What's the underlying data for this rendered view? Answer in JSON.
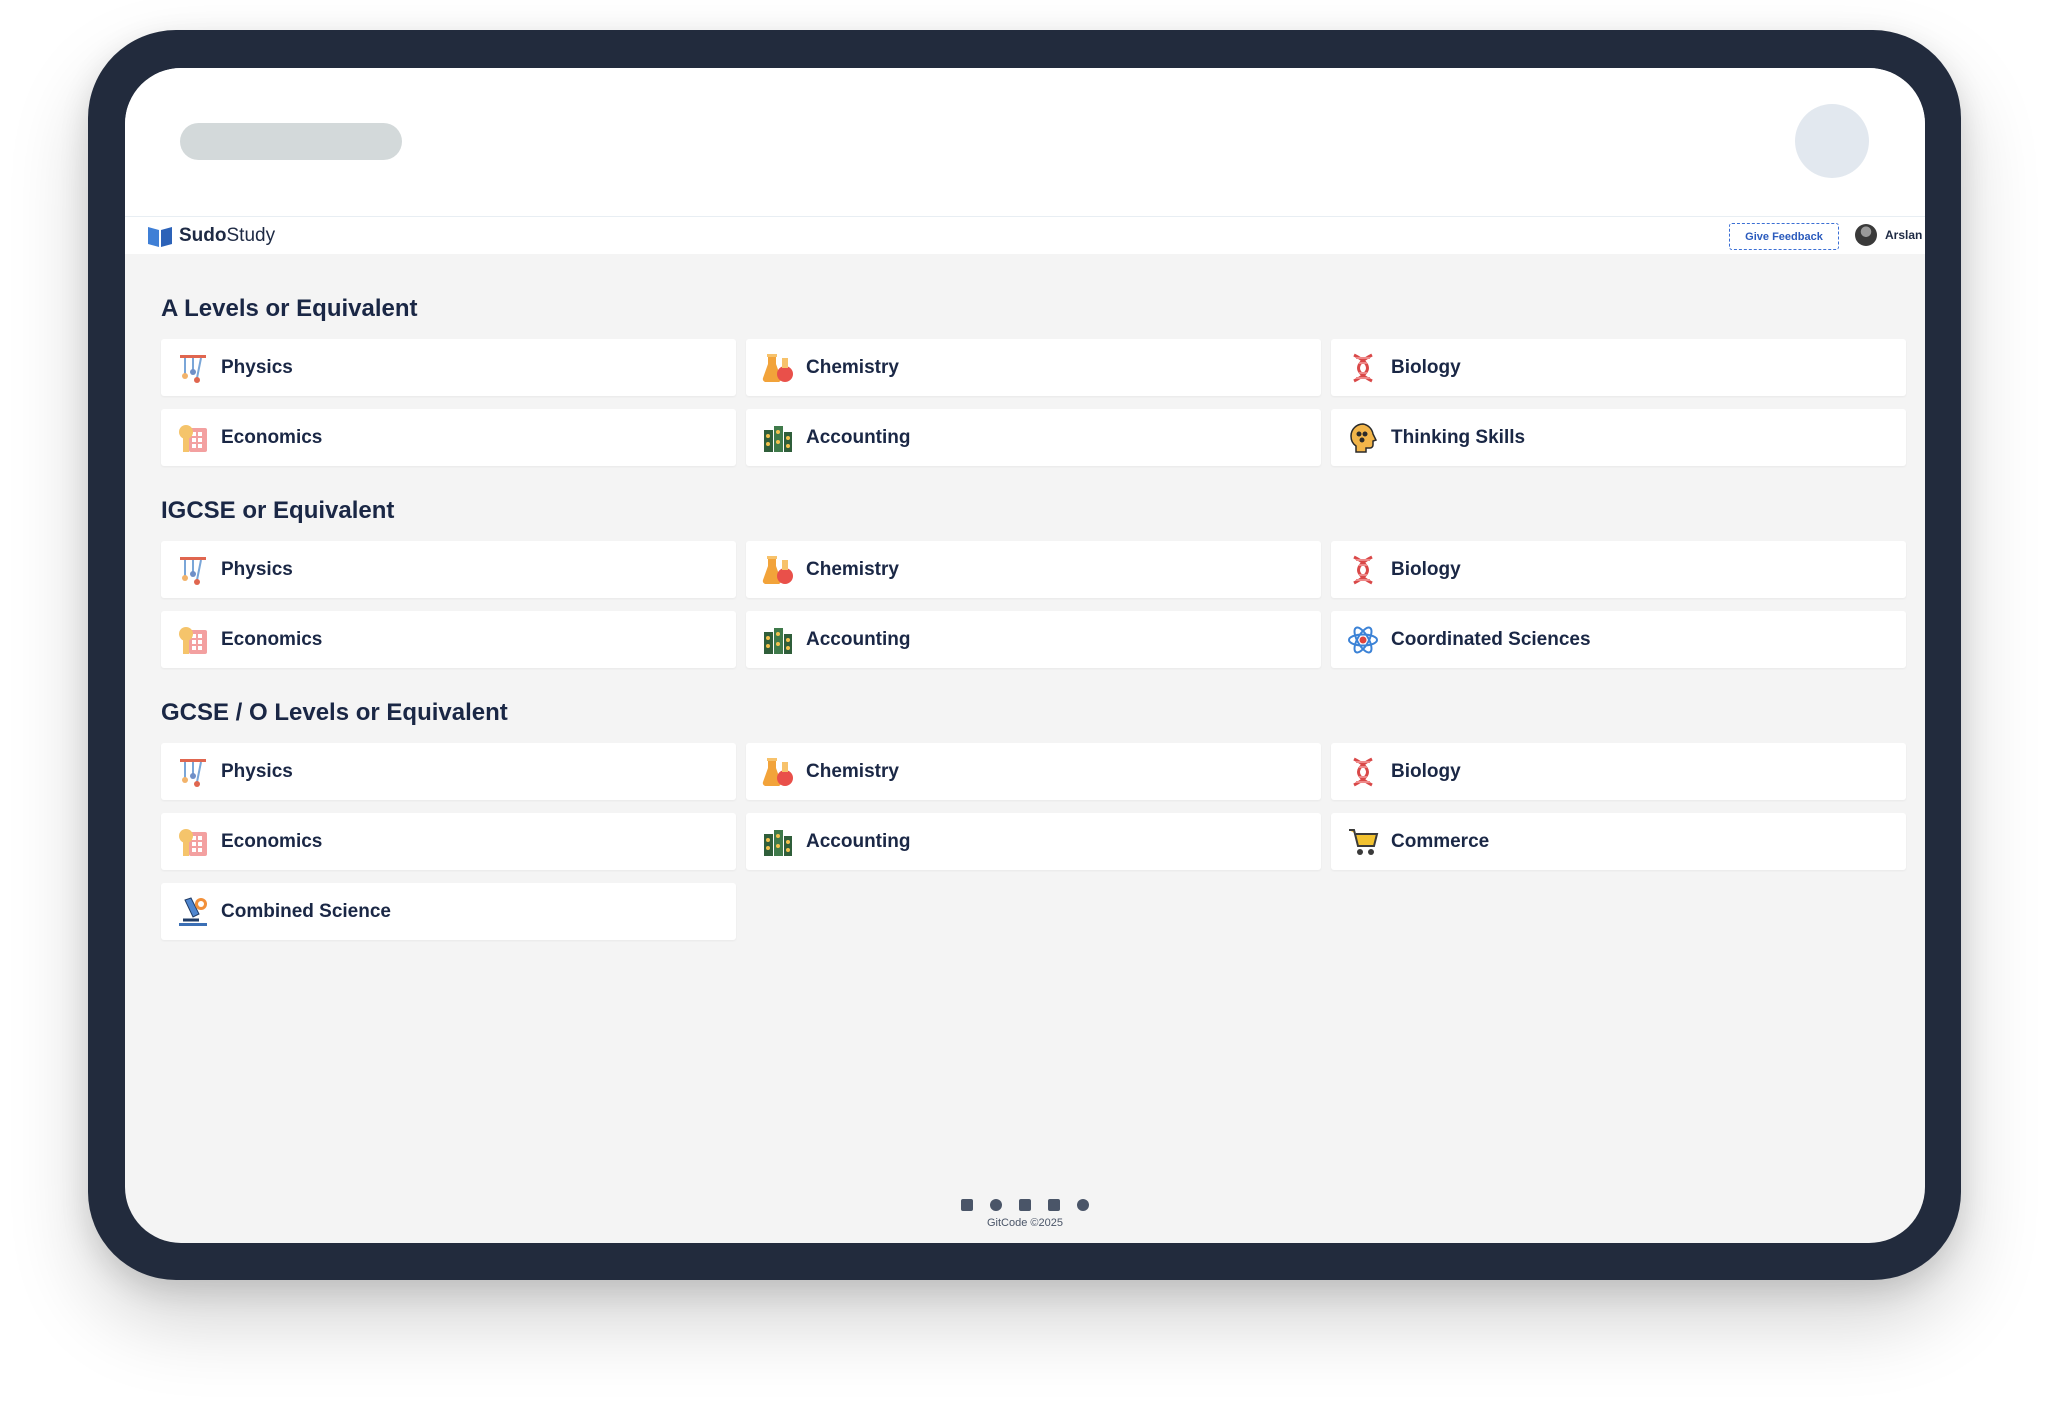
{
  "navbar": {
    "brand_bold": "Sudo",
    "brand_rest": "Study",
    "feedback_label": "Give Feedback",
    "user_name": "Arslan"
  },
  "sections": [
    {
      "title": "A Levels or Equivalent",
      "cards": [
        {
          "label": "Physics",
          "icon": "physics-icon"
        },
        {
          "label": "Chemistry",
          "icon": "flask-icon"
        },
        {
          "label": "Biology",
          "icon": "dna-icon"
        },
        {
          "label": "Economics",
          "icon": "economics-icon"
        },
        {
          "label": "Accounting",
          "icon": "accounting-icon"
        },
        {
          "label": "Thinking Skills",
          "icon": "brain-head-icon"
        }
      ]
    },
    {
      "title": "IGCSE or Equivalent",
      "cards": [
        {
          "label": "Physics",
          "icon": "physics-icon"
        },
        {
          "label": "Chemistry",
          "icon": "flask-icon"
        },
        {
          "label": "Biology",
          "icon": "dna-icon"
        },
        {
          "label": "Economics",
          "icon": "economics-icon"
        },
        {
          "label": "Accounting",
          "icon": "accounting-icon"
        },
        {
          "label": "Coordinated Sciences",
          "icon": "atom-icon"
        }
      ]
    },
    {
      "title": "GCSE / O Levels or Equivalent",
      "cards": [
        {
          "label": "Physics",
          "icon": "physics-icon"
        },
        {
          "label": "Chemistry",
          "icon": "flask-icon"
        },
        {
          "label": "Biology",
          "icon": "dna-icon"
        },
        {
          "label": "Economics",
          "icon": "economics-icon"
        },
        {
          "label": "Accounting",
          "icon": "accounting-icon"
        },
        {
          "label": "Commerce",
          "icon": "shopping-cart-icon"
        },
        {
          "label": "Combined Science",
          "icon": "microscope-icon"
        }
      ]
    }
  ],
  "footer": {
    "social_icons": [
      "facebook-icon",
      "instagram-icon",
      "youtube-icon",
      "linkedin-icon",
      "reddit-icon"
    ],
    "copyright": "GitCode ©2025"
  }
}
